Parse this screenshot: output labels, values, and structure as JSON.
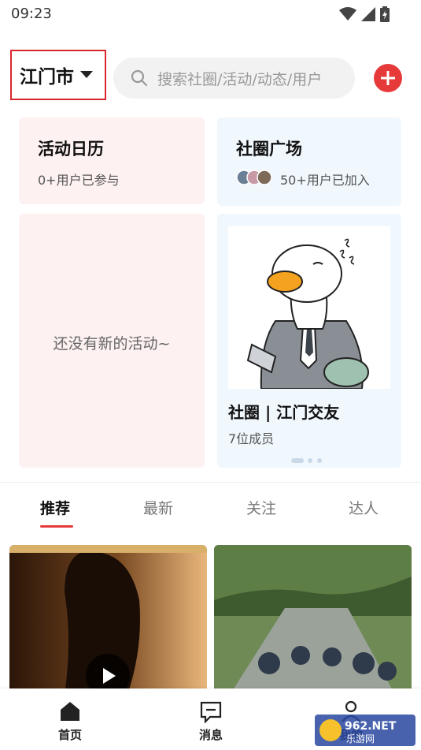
{
  "status": {
    "time": "09:23"
  },
  "header": {
    "city": "江门市",
    "search_placeholder": "搜索社圈/活动/动态/用户"
  },
  "cards": {
    "calendar": {
      "title": "活动日历",
      "sub": "0+用户已参与"
    },
    "square": {
      "title": "社圈广场",
      "sub": "50+用户已加入"
    },
    "empty": {
      "text": "还没有新的活动~"
    },
    "club": {
      "title": "社圈 | 江门交友",
      "sub": "7位成员"
    }
  },
  "tabs": [
    "推荐",
    "最新",
    "关注",
    "达人"
  ],
  "bottom_nav": [
    "首页",
    "消息",
    "我的"
  ],
  "watermark": "962.NET 乐游网",
  "colors": {
    "accent": "#e63a3a",
    "city_border": "#d9262c"
  }
}
